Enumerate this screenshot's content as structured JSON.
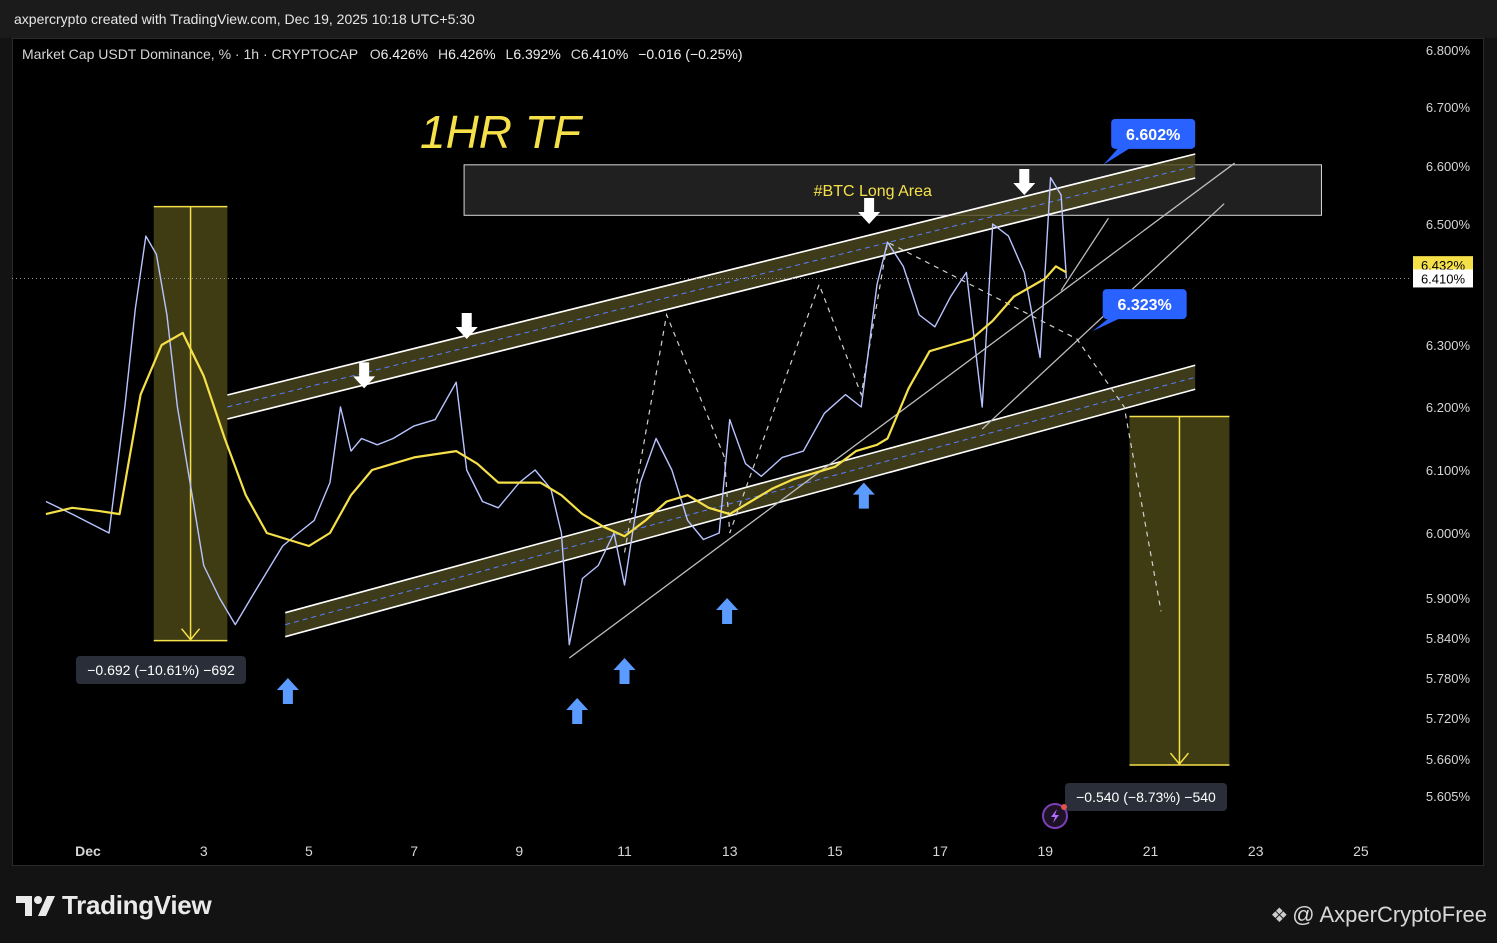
{
  "header": {
    "attribution": "axpercrypto created with TradingView.com, Dec 19, 2025 10:18 UTC+5:30"
  },
  "footer": {
    "brand": "TradingView",
    "credit": "@ AxperCryptoFree"
  },
  "colors": {
    "background": "#000000",
    "price": "#b8c3ff",
    "ma": "#f5e04a",
    "channel": "#ffffff",
    "channel_fill": "#4d4a20",
    "label_blue": "#2962ff",
    "arrow_blue": "#5b9bff",
    "measure_fill": "#4a4716",
    "measure_line": "#f5e04a"
  },
  "chart_data": {
    "type": "line",
    "title": "1HR TF",
    "legend": {
      "symbol": "Market Cap USDT Dominance, % · 1h · CRYPTOCAP",
      "o_label": "O",
      "o_value": "6.426%",
      "h_label": "H",
      "h_value": "6.426%",
      "l_label": "L",
      "l_value": "6.392%",
      "c_label": "C",
      "c_value": "6.410%",
      "change": "−0.016 (−0.25%)"
    },
    "ylim": [
      5.6,
      6.82
    ],
    "xlim": [
      0,
      25.5
    ],
    "x_ticks": [
      {
        "x": 0.8,
        "label": "Dec"
      },
      {
        "x": 3,
        "label": "3"
      },
      {
        "x": 5,
        "label": "5"
      },
      {
        "x": 7,
        "label": "7"
      },
      {
        "x": 9,
        "label": "9"
      },
      {
        "x": 11,
        "label": "11"
      },
      {
        "x": 13,
        "label": "13"
      },
      {
        "x": 15,
        "label": "15"
      },
      {
        "x": 17,
        "label": "17"
      },
      {
        "x": 19,
        "label": "19"
      },
      {
        "x": 21,
        "label": "21"
      },
      {
        "x": 23,
        "label": "23"
      },
      {
        "x": 25,
        "label": "25"
      }
    ],
    "y_ticks": [
      {
        "v": 6.8,
        "label": "6.800%"
      },
      {
        "v": 6.7,
        "label": "6.700%"
      },
      {
        "v": 6.6,
        "label": "6.600%"
      },
      {
        "v": 6.5,
        "label": "6.500%"
      },
      {
        "v": 6.3,
        "label": "6.300%"
      },
      {
        "v": 6.2,
        "label": "6.200%"
      },
      {
        "v": 6.1,
        "label": "6.100%"
      },
      {
        "v": 6.0,
        "label": "6.000%"
      },
      {
        "v": 5.9,
        "label": "5.900%"
      },
      {
        "v": 5.84,
        "label": "5.840%"
      },
      {
        "v": 5.78,
        "label": "5.780%"
      },
      {
        "v": 5.72,
        "label": "5.720%"
      },
      {
        "v": 5.66,
        "label": "5.660%"
      },
      {
        "v": 5.605,
        "label": "5.605%"
      }
    ],
    "price_tags": {
      "ma": {
        "v": 6.432,
        "label": "6.432%"
      },
      "last": {
        "v": 6.41,
        "label": "6.410%"
      }
    },
    "series": [
      {
        "name": "price",
        "x": [
          0,
          0.5,
          1.2,
          1.5,
          1.7,
          1.9,
          2.1,
          2.3,
          2.5,
          2.8,
          3.0,
          3.3,
          3.6,
          3.9,
          4.2,
          4.5,
          4.8,
          5.1,
          5.4,
          5.6,
          5.8,
          6.0,
          6.3,
          6.6,
          7.0,
          7.4,
          7.8,
          8.0,
          8.3,
          8.6,
          9.0,
          9.3,
          9.6,
          9.8,
          9.95,
          10.2,
          10.5,
          10.8,
          11.0,
          11.3,
          11.6,
          11.9,
          12.2,
          12.5,
          12.8,
          13.0,
          13.3,
          13.6,
          14.0,
          14.4,
          14.8,
          15.2,
          15.5,
          15.8,
          16.0,
          16.3,
          16.6,
          16.9,
          17.2,
          17.5,
          17.8,
          18.0,
          18.3,
          18.6,
          18.9,
          19.1,
          19.3,
          19.4
        ],
        "y": [
          6.05,
          6.03,
          6.0,
          6.2,
          6.36,
          6.48,
          6.45,
          6.35,
          6.2,
          6.05,
          5.95,
          5.9,
          5.86,
          5.9,
          5.94,
          5.98,
          6.0,
          6.02,
          6.08,
          6.2,
          6.13,
          6.15,
          6.14,
          6.15,
          6.17,
          6.18,
          6.24,
          6.1,
          6.05,
          6.04,
          6.08,
          6.1,
          6.07,
          6.0,
          5.83,
          5.93,
          5.95,
          6.0,
          5.92,
          6.08,
          6.15,
          6.1,
          6.02,
          5.99,
          6.0,
          6.18,
          6.11,
          6.09,
          6.12,
          6.13,
          6.19,
          6.22,
          6.2,
          6.4,
          6.47,
          6.43,
          6.35,
          6.33,
          6.38,
          6.42,
          6.2,
          6.5,
          6.48,
          6.42,
          6.28,
          6.58,
          6.55,
          6.41
        ]
      },
      {
        "name": "ma",
        "x": [
          0,
          0.5,
          1.0,
          1.4,
          1.8,
          2.2,
          2.6,
          3.0,
          3.4,
          3.8,
          4.2,
          4.6,
          5.0,
          5.4,
          5.8,
          6.2,
          6.6,
          7.0,
          7.4,
          7.8,
          8.2,
          8.6,
          9.0,
          9.4,
          9.8,
          10.2,
          10.6,
          11.0,
          11.4,
          11.8,
          12.2,
          12.6,
          13.0,
          13.4,
          13.8,
          14.2,
          14.6,
          15.0,
          15.4,
          15.8,
          16.0,
          16.4,
          16.8,
          17.2,
          17.6,
          18.0,
          18.4,
          18.8,
          19.0,
          19.2,
          19.4
        ],
        "y": [
          6.03,
          6.04,
          6.035,
          6.03,
          6.22,
          6.3,
          6.32,
          6.25,
          6.15,
          6.06,
          6.0,
          5.99,
          5.98,
          6.0,
          6.06,
          6.1,
          6.11,
          6.12,
          6.125,
          6.13,
          6.11,
          6.08,
          6.08,
          6.08,
          6.06,
          6.03,
          6.01,
          5.995,
          6.02,
          6.05,
          6.06,
          6.04,
          6.03,
          6.05,
          6.07,
          6.085,
          6.095,
          6.105,
          6.13,
          6.14,
          6.15,
          6.23,
          6.29,
          6.3,
          6.31,
          6.34,
          6.38,
          6.4,
          6.41,
          6.43,
          6.42
        ]
      }
    ],
    "annotations": {
      "btc_area_label": "#BTC Long Area",
      "btc_area": {
        "x": [
          7.95,
          24.25
        ],
        "y": [
          6.515,
          6.602
        ]
      },
      "target_high": {
        "x": 20.1,
        "v": 6.602,
        "label": "6.602%"
      },
      "target_low": {
        "x": 19.9,
        "v": 6.323,
        "label": "6.323%"
      },
      "measure_left": {
        "x": [
          2.05,
          3.45
        ],
        "y": [
          6.53,
          5.836
        ],
        "label": "−0.692 (−10.61%) −692"
      },
      "measure_right": {
        "x": [
          20.6,
          22.5
        ],
        "y": [
          6.185,
          5.651
        ],
        "label": "−0.540 (−8.73%) −540"
      },
      "upper_channel": [
        {
          "x": 3.45,
          "y": 6.2
        },
        {
          "x": 21.85,
          "y": 6.6
        }
      ],
      "lower_channel": [
        {
          "x": 4.55,
          "y": 5.86
        },
        {
          "x": 21.85,
          "y": 6.248
        }
      ],
      "trendlines": [
        [
          {
            "x": 9.95,
            "y": 5.81
          },
          {
            "x": 22.6,
            "y": 6.605
          }
        ],
        [
          {
            "x": 17.8,
            "y": 6.165
          },
          {
            "x": 22.4,
            "y": 6.535
          }
        ],
        [
          {
            "x": 19.3,
            "y": 6.39
          },
          {
            "x": 20.2,
            "y": 6.51
          }
        ]
      ],
      "dashed_path": [
        {
          "x": 11.0,
          "y": 5.97
        },
        {
          "x": 11.8,
          "y": 6.35
        },
        {
          "x": 12.9,
          "y": 6.12
        },
        {
          "x": 13.0,
          "y": 6.0
        },
        {
          "x": 14.7,
          "y": 6.4
        },
        {
          "x": 15.5,
          "y": 6.22
        },
        {
          "x": 16.0,
          "y": 6.47
        },
        {
          "x": 19.6,
          "y": 6.31
        },
        {
          "x": 20.5,
          "y": 6.2
        },
        {
          "x": 21.2,
          "y": 5.88
        }
      ],
      "down_arrows": [
        {
          "x": 6.05,
          "y": 6.23
        },
        {
          "x": 8.0,
          "y": 6.31
        },
        {
          "x": 15.65,
          "y": 6.5
        },
        {
          "x": 18.6,
          "y": 6.55
        }
      ],
      "up_arrows": [
        {
          "x": 4.6,
          "y": 5.78
        },
        {
          "x": 10.1,
          "y": 5.75
        },
        {
          "x": 11.0,
          "y": 5.81
        },
        {
          "x": 12.95,
          "y": 5.9
        },
        {
          "x": 15.55,
          "y": 6.08
        }
      ]
    }
  }
}
